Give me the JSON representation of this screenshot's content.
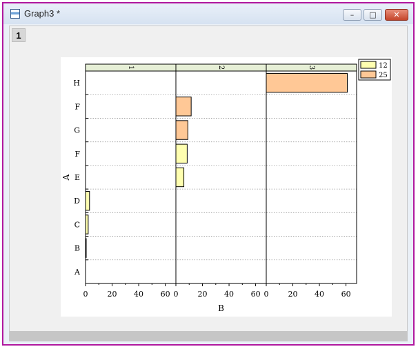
{
  "window": {
    "title": "Graph3 *",
    "layer_label": "1"
  },
  "chart_data": {
    "type": "bar",
    "orientation": "horizontal",
    "grouped_by": "panel",
    "panels": [
      "1",
      "2",
      "3"
    ],
    "categories": [
      "A",
      "B",
      "C",
      "D",
      "E",
      "F",
      "G",
      "F",
      "H"
    ],
    "xlabel": "B",
    "ylabel": "A",
    "xlim": [
      0,
      68
    ],
    "xticks": [
      0,
      20,
      40,
      60
    ],
    "bars": [
      {
        "panel": 0,
        "category_index": 1,
        "value": 0.5,
        "series": 0
      },
      {
        "panel": 0,
        "category_index": 2,
        "value": 2,
        "series": 0
      },
      {
        "panel": 0,
        "category_index": 3,
        "value": 3,
        "series": 0
      },
      {
        "panel": 1,
        "category_index": 4,
        "value": 6,
        "series": 0
      },
      {
        "panel": 1,
        "category_index": 5,
        "value": 8.5,
        "series": 0
      },
      {
        "panel": 1,
        "category_index": 6,
        "value": 9,
        "series": 1
      },
      {
        "panel": 1,
        "category_index": 7,
        "value": 11.5,
        "series": 1
      },
      {
        "panel": 2,
        "category_index": 8,
        "value": 61,
        "series": 1
      }
    ],
    "legend": [
      {
        "label": "12",
        "color": "#ffffb0"
      },
      {
        "label": "25",
        "color": "#ffc896"
      }
    ],
    "legend_placement": "top-right, outside",
    "grid": "dotted horizontal lines between categories",
    "strip_color": "#e6efd6"
  }
}
